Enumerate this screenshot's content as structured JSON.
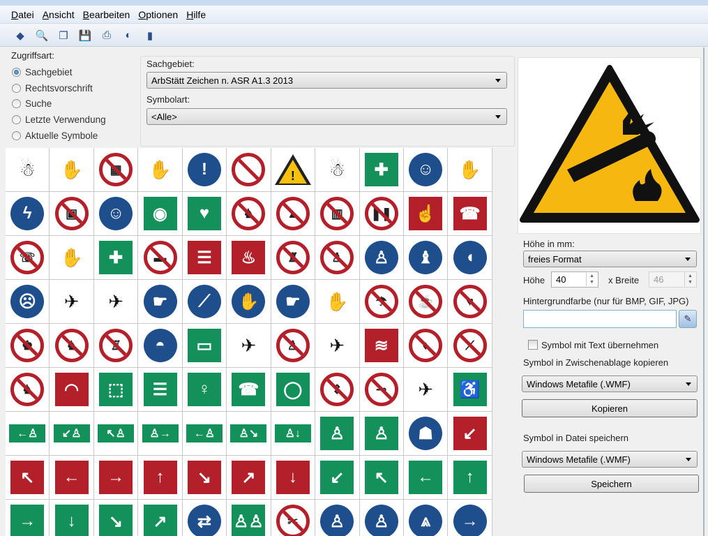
{
  "menu": [
    "Datei",
    "Ansicht",
    "Bearbeiten",
    "Optionen",
    "Hilfe"
  ],
  "toolbar": [
    {
      "icon": "info-icon",
      "glyph": "◆"
    },
    {
      "icon": "preview-icon",
      "glyph": "🔍"
    },
    {
      "icon": "copy-icon",
      "glyph": "❐"
    },
    {
      "icon": "save-icon",
      "glyph": "💾"
    },
    {
      "icon": "print-icon",
      "glyph": "⎙"
    },
    {
      "icon": "export-icon",
      "glyph": "◐"
    },
    {
      "icon": "book-icon",
      "glyph": "▮"
    }
  ],
  "access": {
    "title": "Zugriffsart:",
    "options": [
      "Sachgebiet",
      "Rechtsvorschrift",
      "Suche",
      "Letzte Verwendung",
      "Aktuelle Symbole"
    ],
    "selected": 0
  },
  "filter": {
    "sachgebiet_label": "Sachgebiet:",
    "sachgebiet_value": "ArbStätt Zeichen n. ASR A1.3 2013",
    "symbolart_label": "Symbolart:",
    "symbolart_value": "<Alle>"
  },
  "symbols": [
    [
      [
        "pict",
        "☃"
      ],
      [
        "pict",
        "✋"
      ],
      [
        "prohibit",
        "▦"
      ],
      [
        "pict",
        "✋"
      ],
      [
        "mandatory",
        "!"
      ],
      [
        "prohibit",
        ""
      ],
      [
        "warning",
        "!"
      ],
      [
        "pict",
        "☃"
      ],
      [
        "rescue",
        "✚"
      ],
      [
        "mandatory",
        "☺"
      ],
      [
        "pict",
        "✋"
      ]
    ],
    [
      [
        "mandatory",
        "ϟ"
      ],
      [
        "prohibit",
        "▣"
      ],
      [
        "mandatory",
        "☺"
      ],
      [
        "rescue",
        "◉"
      ],
      [
        "rescue",
        "♥"
      ],
      [
        "prohibit",
        "♞"
      ],
      [
        "prohibit",
        "▲"
      ],
      [
        "prohibit",
        "▥"
      ],
      [
        "prohibit",
        "❚❚"
      ],
      [
        "fire",
        "☝"
      ],
      [
        "fire",
        "☎"
      ]
    ],
    [
      [
        "prohibit",
        "☏"
      ],
      [
        "pict",
        "✋"
      ],
      [
        "rescue",
        "✚"
      ],
      [
        "prohibit",
        "▬"
      ],
      [
        "fire",
        "☰"
      ],
      [
        "fire",
        "♨"
      ],
      [
        "prohibit",
        "♜"
      ],
      [
        "prohibit",
        "♙"
      ],
      [
        "mandatory",
        "♙"
      ],
      [
        "mandatory",
        "♝"
      ],
      [
        "mandatory",
        "◖"
      ]
    ],
    [
      [
        "mandatory",
        "☹"
      ],
      [
        "pict",
        "✈"
      ],
      [
        "pict",
        "✈"
      ],
      [
        "mandatory",
        "☛"
      ],
      [
        "mandatory",
        "⟋"
      ],
      [
        "mandatory",
        "✋"
      ],
      [
        "mandatory",
        "☛"
      ],
      [
        "pict",
        "✋"
      ],
      [
        "prohibit",
        "☂"
      ],
      [
        "prohibit",
        "☕"
      ],
      [
        "prohibit",
        "♥"
      ]
    ],
    [
      [
        "prohibit",
        "♚"
      ],
      [
        "prohibit",
        "♞"
      ],
      [
        "prohibit",
        "♖"
      ],
      [
        "mandatory",
        "◓"
      ],
      [
        "rescue",
        "▭"
      ],
      [
        "pict",
        "✈"
      ],
      [
        "prohibit",
        "♙"
      ],
      [
        "pict",
        "✈"
      ],
      [
        "fire",
        "≋"
      ],
      [
        "prohibit",
        "♦"
      ],
      [
        "prohibit",
        "⟋"
      ]
    ],
    [
      [
        "prohibit",
        "♞"
      ],
      [
        "fire",
        "◠"
      ],
      [
        "rescue",
        "⬚"
      ],
      [
        "rescue",
        "☰"
      ],
      [
        "rescue",
        "♀"
      ],
      [
        "rescue",
        "☎"
      ],
      [
        "rescue",
        "◯"
      ],
      [
        "prohibit",
        "⇕"
      ],
      [
        "prohibit",
        "⊸"
      ],
      [
        "pict",
        "✈"
      ],
      [
        "rescue",
        "♿"
      ]
    ],
    [
      [
        "exit",
        "←♙"
      ],
      [
        "exit",
        "↙♙"
      ],
      [
        "exit",
        "↖♙"
      ],
      [
        "exit",
        "♙→"
      ],
      [
        "exit",
        "←♙"
      ],
      [
        "exit",
        "♙↘"
      ],
      [
        "exit",
        "♙↓"
      ],
      [
        "rescue",
        "♙"
      ],
      [
        "rescue",
        "♙"
      ],
      [
        "mandatory",
        "☗"
      ],
      [
        "fire",
        "↙"
      ]
    ],
    [
      [
        "fire",
        "↖"
      ],
      [
        "fire",
        "←"
      ],
      [
        "fire",
        "→"
      ],
      [
        "fire",
        "↑"
      ],
      [
        "fire",
        "↘"
      ],
      [
        "fire",
        "↗"
      ],
      [
        "fire",
        "↓"
      ],
      [
        "rescue",
        "↙"
      ],
      [
        "rescue",
        "↖"
      ],
      [
        "rescue",
        "←"
      ],
      [
        "rescue",
        "↑"
      ]
    ],
    [
      [
        "rescue",
        "→"
      ],
      [
        "rescue",
        "↓"
      ],
      [
        "rescue",
        "↘"
      ],
      [
        "rescue",
        "↗"
      ],
      [
        "mandatory",
        "⇄"
      ],
      [
        "rescue",
        "♙♙"
      ],
      [
        "prohibit",
        "✂"
      ],
      [
        "mandatory",
        "♙"
      ],
      [
        "mandatory",
        "♙"
      ],
      [
        "mandatory",
        "⩓"
      ],
      [
        "mandatory",
        "→"
      ]
    ]
  ],
  "preview": {
    "icon": "explosion-gas-cylinder-warning-icon"
  },
  "size": {
    "label": "Höhe in mm:",
    "format": "freies Format",
    "height_label": "Höhe",
    "height": "40",
    "width_label": "x Breite",
    "width": "46"
  },
  "background": {
    "label": "Hintergrundfarbe (nur für BMP, GIF, JPG)",
    "value": ""
  },
  "with_text": {
    "label": "Symbol mit Text übernehmen",
    "checked": false
  },
  "clipboard": {
    "label": "Symbol in Zwischenablage kopieren",
    "format": "Windows Metafile (.WMF)",
    "button": "Kopieren"
  },
  "file": {
    "label": "Symbol in Datei speichern",
    "format": "Windows Metafile (.WMF)",
    "button": "Speichern"
  }
}
